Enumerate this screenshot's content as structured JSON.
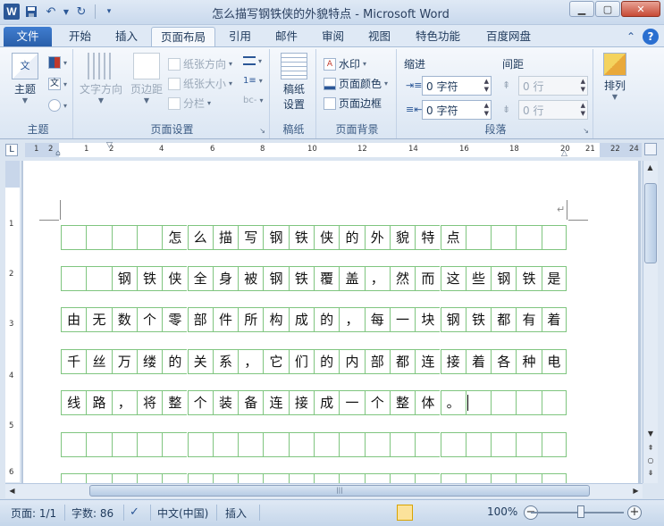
{
  "titlebar": {
    "title": "怎么描写钢铁侠的外貌特点 - Microsoft Word",
    "app_icon_letter": "W"
  },
  "tabs": {
    "file": "文件",
    "items": [
      "开始",
      "插入",
      "页面布局",
      "引用",
      "邮件",
      "审阅",
      "视图",
      "特色功能",
      "百度网盘"
    ],
    "active": "页面布局"
  },
  "ribbon": {
    "theme": {
      "label": "主题",
      "group": "主题"
    },
    "page_setup": {
      "text_direction": "文字方向",
      "margins": "页边距",
      "orientation": "纸张方向",
      "size": "纸张大小",
      "columns": "分栏",
      "group": "页面设置"
    },
    "manuscript": {
      "label_line1": "稿纸",
      "label_line2": "设置",
      "group": "稿纸"
    },
    "page_background": {
      "watermark": "水印",
      "page_color": "页面颜色",
      "page_borders": "页面边框",
      "group": "页面背景"
    },
    "paragraph": {
      "indent_title": "缩进",
      "spacing_title": "间距",
      "indent_left": "0 字符",
      "indent_right": "0 字符",
      "spacing_before": "0 行",
      "spacing_after": "0 行",
      "group": "段落"
    },
    "arrange": {
      "label": "排列"
    }
  },
  "ruler": {
    "numbers": [
      "1",
      "2",
      "1",
      "2",
      "4",
      "6",
      "8",
      "10",
      "12",
      "14",
      "16",
      "18",
      "20",
      "21",
      "22",
      "24"
    ],
    "v_numbers": [
      "1",
      "2",
      "3",
      "4",
      "5",
      "6"
    ]
  },
  "document": {
    "grid_rows": [
      [
        "",
        "",
        "",
        "",
        "怎",
        "么",
        "描",
        "写",
        "钢",
        "铁",
        "侠",
        "的",
        "外",
        "貌",
        "特",
        "点",
        "",
        "",
        "",
        ""
      ],
      [
        "",
        "",
        "钢",
        "铁",
        "侠",
        "全",
        "身",
        "被",
        "钢",
        "铁",
        "覆",
        "盖",
        "，",
        "然",
        "而",
        "这",
        "些",
        "钢",
        "铁",
        "是"
      ],
      [
        "由",
        "无",
        "数",
        "个",
        "零",
        "部",
        "件",
        "所",
        "构",
        "成",
        "的",
        "，",
        "每",
        "一",
        "块",
        "钢",
        "铁",
        "都",
        "有",
        "着"
      ],
      [
        "千",
        "丝",
        "万",
        "缕",
        "的",
        "关",
        "系",
        "，",
        "它",
        "们",
        "的",
        "内",
        "部",
        "都",
        "连",
        "接",
        "着",
        "各",
        "种",
        "电"
      ],
      [
        "线",
        "路",
        "，",
        "将",
        "整",
        "个",
        "装",
        "备",
        "连",
        "接",
        "成",
        "一",
        "个",
        "整",
        "体",
        "。",
        "",
        "",
        "",
        ""
      ],
      [
        "",
        "",
        "",
        "",
        "",
        "",
        "",
        "",
        "",
        "",
        "",
        "",
        "",
        "",
        "",
        "",
        "",
        "",
        "",
        ""
      ],
      [
        "",
        "",
        "",
        "",
        "",
        "",
        "",
        "",
        "",
        "",
        "",
        "",
        "",
        "",
        "",
        "",
        "",
        "",
        "",
        ""
      ]
    ],
    "paragraph_mark": "↵"
  },
  "statusbar": {
    "page": "页面: 1/1",
    "word_count": "字数: 86",
    "language": "中文(中国)",
    "mode": "插入",
    "zoom": "100%"
  },
  "colors": {
    "grid_line": "#7fc57f",
    "file_tab": "#2a5fa9",
    "ribbon_bg": "#dbe6f3"
  }
}
